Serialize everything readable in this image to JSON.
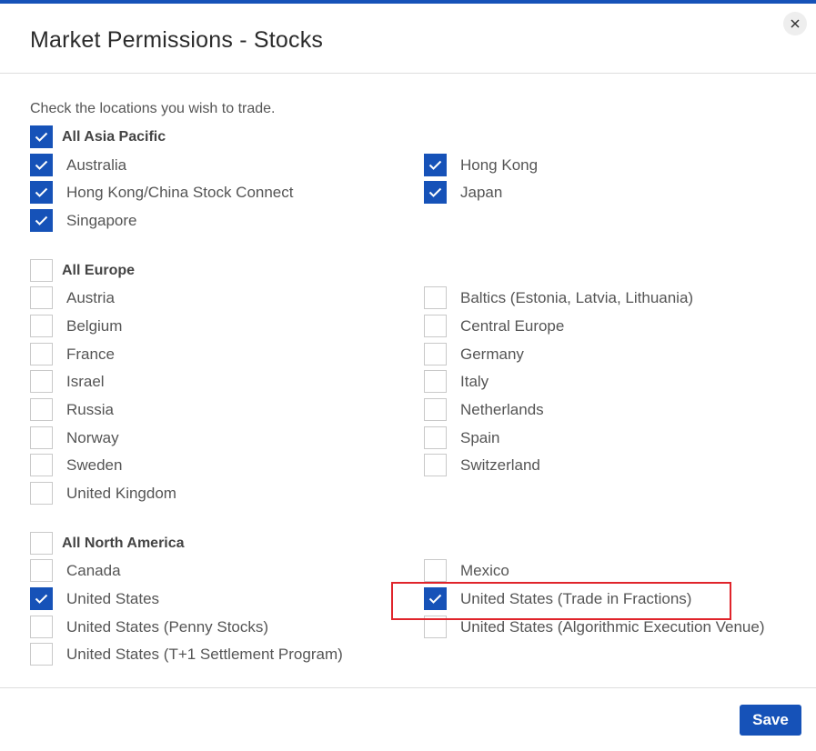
{
  "dialog": {
    "title": "Market Permissions - Stocks",
    "instruction": "Check the locations you wish to trade.",
    "save_label": "Save",
    "accent_color": "#1652b8",
    "highlight_color": "#e0242b"
  },
  "asia_pacific": {
    "group_label": "All Asia Pacific",
    "group_checked": true,
    "items": [
      {
        "label": "Australia",
        "checked": true
      },
      {
        "label": "Hong Kong",
        "checked": true
      },
      {
        "label": "Hong Kong/China Stock Connect",
        "checked": true
      },
      {
        "label": "Japan",
        "checked": true
      },
      {
        "label": "Singapore",
        "checked": true
      }
    ]
  },
  "europe": {
    "group_label": "All Europe",
    "group_checked": false,
    "items": [
      {
        "label": "Austria",
        "checked": false
      },
      {
        "label": "Baltics (Estonia, Latvia, Lithuania)",
        "checked": false
      },
      {
        "label": "Belgium",
        "checked": false
      },
      {
        "label": "Central Europe",
        "checked": false
      },
      {
        "label": "France",
        "checked": false
      },
      {
        "label": "Germany",
        "checked": false
      },
      {
        "label": "Israel",
        "checked": false
      },
      {
        "label": "Italy",
        "checked": false
      },
      {
        "label": "Russia",
        "checked": false
      },
      {
        "label": "Netherlands",
        "checked": false
      },
      {
        "label": "Norway",
        "checked": false
      },
      {
        "label": "Spain",
        "checked": false
      },
      {
        "label": "Sweden",
        "checked": false
      },
      {
        "label": "Switzerland",
        "checked": false
      },
      {
        "label": "United Kingdom",
        "checked": false
      }
    ]
  },
  "north_america": {
    "group_label": "All North America",
    "group_checked": false,
    "items": [
      {
        "label": "Canada",
        "checked": false
      },
      {
        "label": "Mexico",
        "checked": false
      },
      {
        "label": "United States",
        "checked": true
      },
      {
        "label": "United States (Trade in Fractions)",
        "checked": true
      },
      {
        "label": "United States (Penny Stocks)",
        "checked": false
      },
      {
        "label": "United States (Algorithmic Execution Venue)",
        "checked": false
      },
      {
        "label": "United States (T+1 Settlement Program)",
        "checked": false
      }
    ]
  }
}
